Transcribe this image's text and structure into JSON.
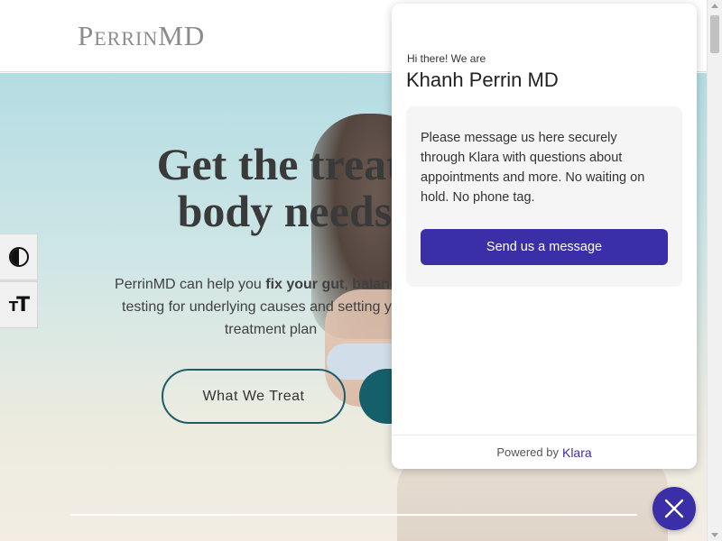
{
  "header": {
    "logo_perrin": "Perrin",
    "logo_md": "MD"
  },
  "hero": {
    "title_line1": "Get the treatm",
    "title_line2": "body needs t",
    "text_line1_pre": "PerrinMD can help you ",
    "text_line1_b1": "fix your gut",
    "text_line1_mid": ", ",
    "text_line1_b2": "balance yo",
    "text_line2": "testing for underlying causes and setting you u",
    "text_line3": "treatment plan",
    "btn_outline_label": "What We Treat"
  },
  "accessibility": {
    "contrast_icon": "contrast-icon",
    "text_size_icon": "text-size-icon",
    "text_size_glyph": "T"
  },
  "chat_widget": {
    "greeting": "Hi there! We are",
    "title": "Khanh Perrin MD",
    "message": "Please message us here securely through Klara with questions about appointments and more. No waiting on hold. No phone tag.",
    "send_button_label": "Send us a message",
    "powered_by": "Powered by",
    "brand": "Klara",
    "close_icon": "close-icon",
    "accent_color": "#3a2fa6"
  },
  "colors": {
    "teal": "#155f6b",
    "hero_bg_top": "#b4dde3"
  }
}
